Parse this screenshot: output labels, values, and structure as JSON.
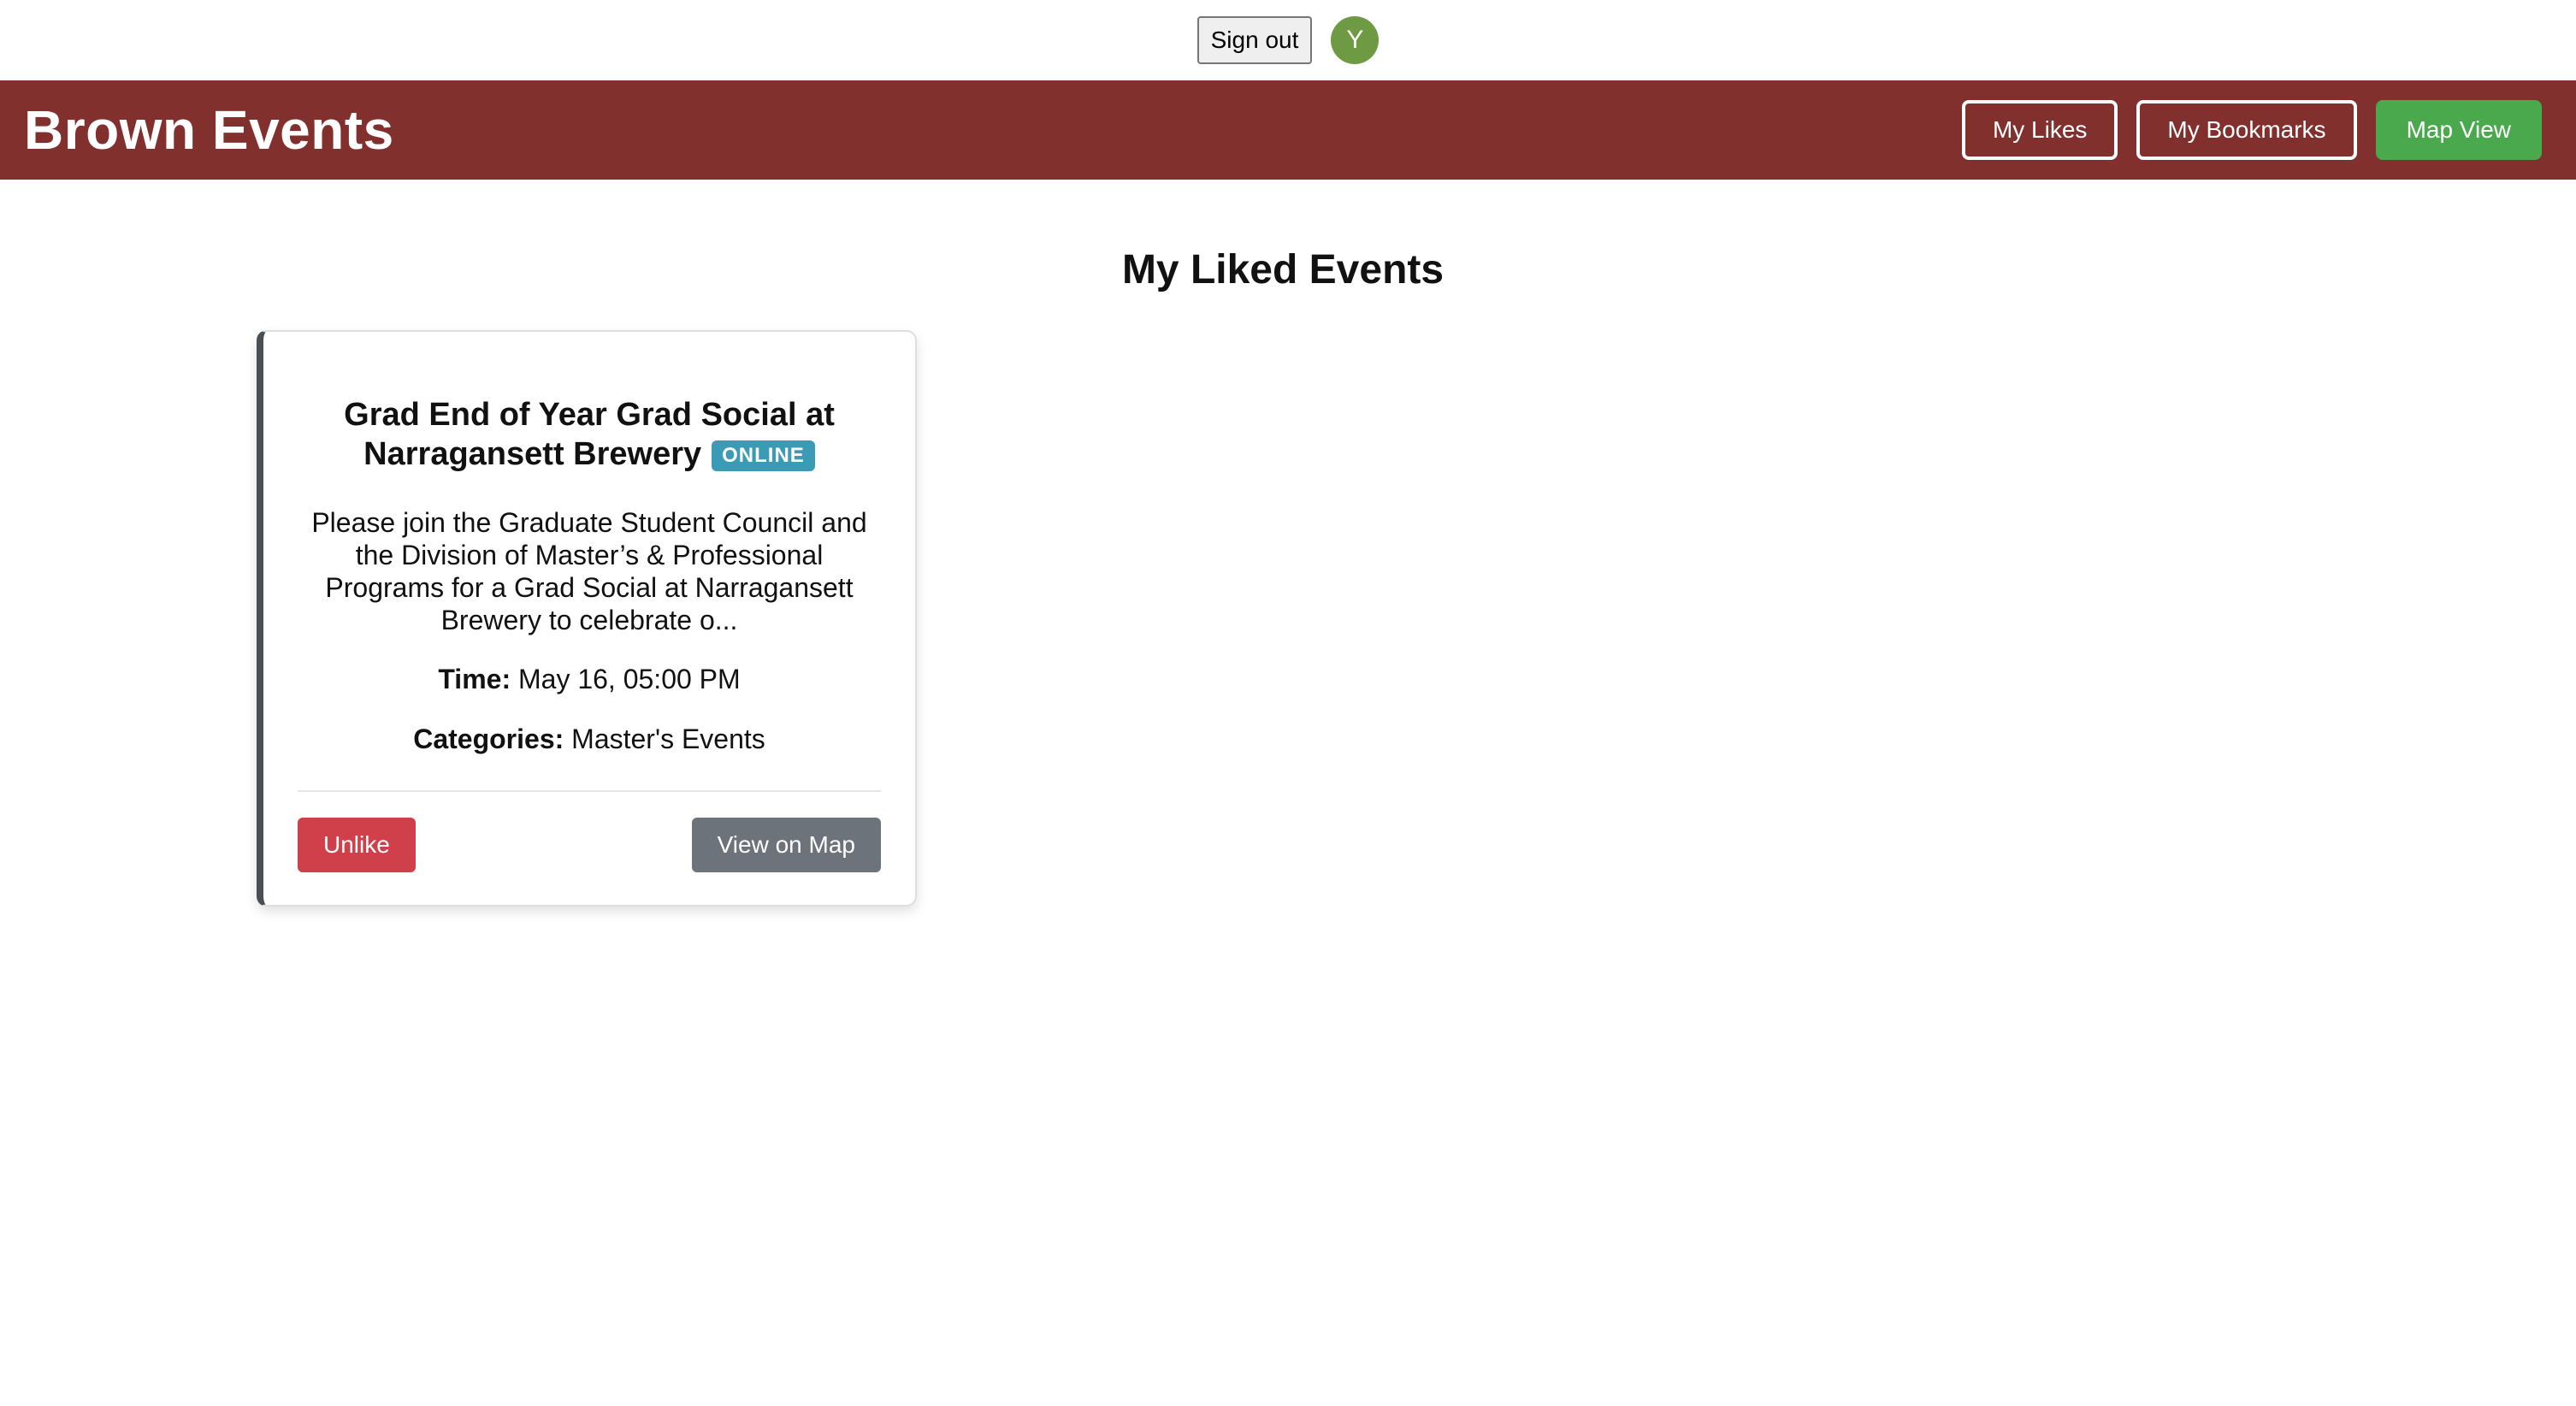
{
  "auth": {
    "sign_out_label": "Sign out",
    "avatar_initial": "Y"
  },
  "header": {
    "brand": "Brown Events",
    "nav": {
      "my_likes": "My Likes",
      "my_bookmarks": "My Bookmarks",
      "map_view": "Map View"
    }
  },
  "main": {
    "title": "My Liked Events",
    "events": [
      {
        "title": "Grad End of Year Grad Social at Narragansett Brewery",
        "badge": "ONLINE",
        "description": "Please join the Graduate Student Council and the Division of Master’s & Professional Programs for a Grad Social at Narragansett Brewery to celebrate o...",
        "time_label": "Time:",
        "time_value": "May 16, 05:00 PM",
        "categories_label": "Categories:",
        "categories_value": "Master's Events",
        "unlike_label": "Unlike",
        "view_on_map_label": "View on Map"
      }
    ]
  },
  "colors": {
    "header_bg": "#82302d",
    "map_view_bg": "#4aa84d",
    "badge_bg": "#3b9bb5",
    "unlike_bg": "#d0404b",
    "view_map_bg": "#6d737a",
    "avatar_bg": "#6f9a44"
  }
}
